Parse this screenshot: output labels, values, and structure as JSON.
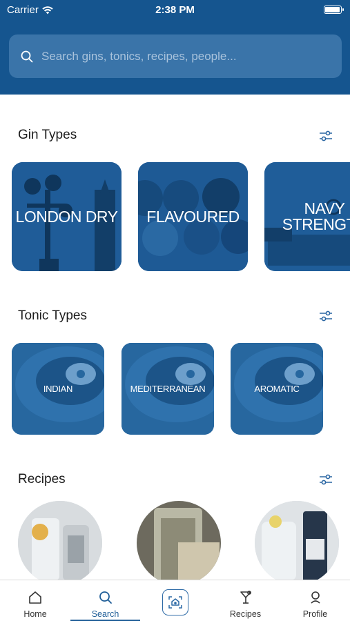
{
  "status_bar": {
    "carrier": "Carrier",
    "time": "2:38 PM",
    "battery_level": 0.95
  },
  "search": {
    "placeholder": "Search gins, tonics, recipes, people..."
  },
  "sections": {
    "gin_types": {
      "title": "Gin Types",
      "items": [
        {
          "label": "LONDON DRY"
        },
        {
          "label": "FLAVOURED"
        },
        {
          "label": "NAVY STRENGTH"
        }
      ]
    },
    "tonic_types": {
      "title": "Tonic Types",
      "items": [
        {
          "label": "INDIAN"
        },
        {
          "label": "MEDITERRANEAN"
        },
        {
          "label": "AROMATIC"
        }
      ]
    },
    "recipes": {
      "title": "Recipes"
    }
  },
  "tabbar": {
    "tabs": [
      {
        "label": "Home",
        "icon": "home-icon"
      },
      {
        "label": "Search",
        "icon": "search-icon",
        "active": true
      },
      {
        "label": "",
        "icon": "camera-icon"
      },
      {
        "label": "Recipes",
        "icon": "cocktail-glass-icon"
      },
      {
        "label": "Profile",
        "icon": "person-icon"
      }
    ]
  },
  "colors": {
    "header": "#15558f",
    "search_field": "#3a74a9",
    "accent": "#1e5d97",
    "card": "#1d5b96"
  }
}
